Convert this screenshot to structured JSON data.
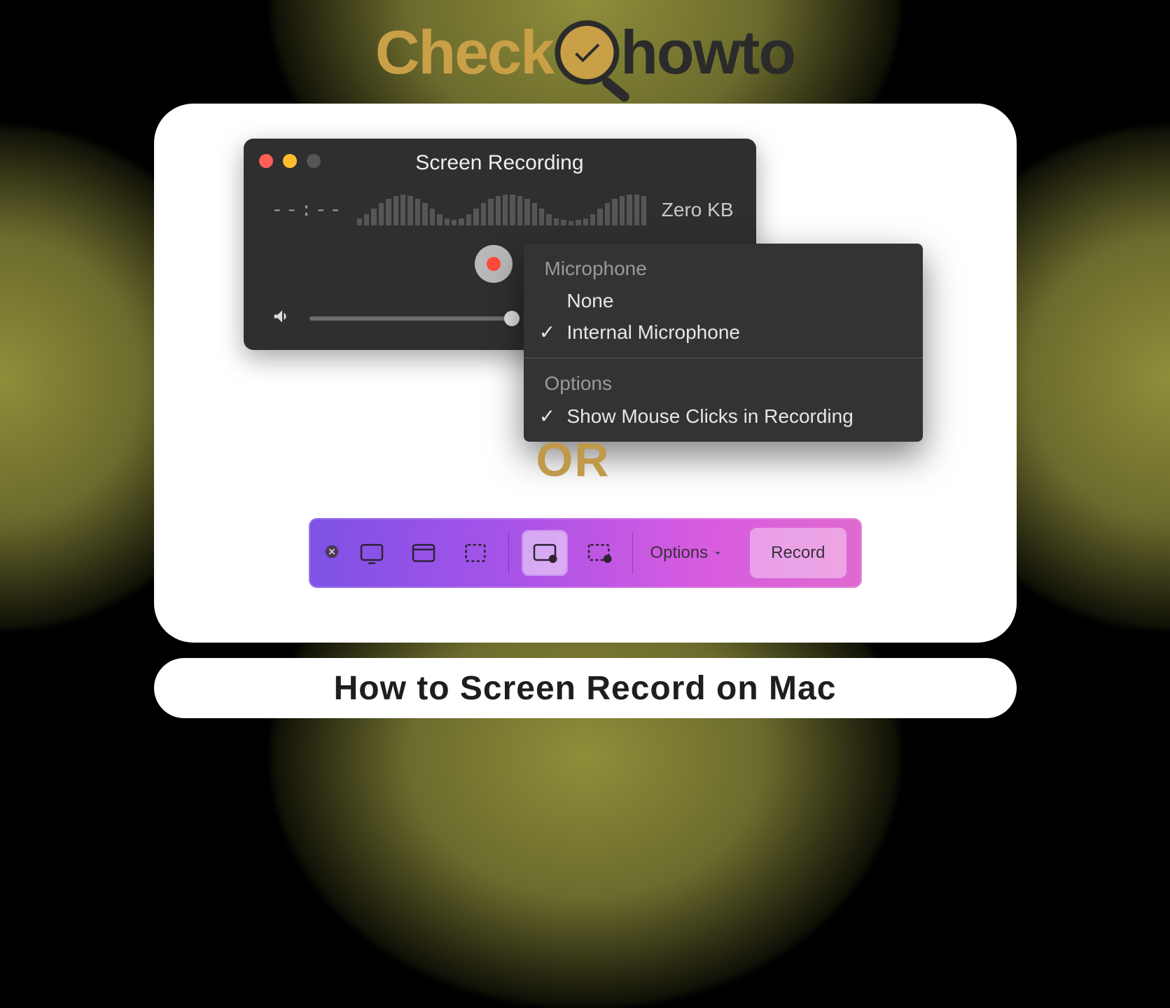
{
  "logo": {
    "part1": "Check",
    "part2": "howto"
  },
  "quicktime": {
    "title": "Screen Recording",
    "time": "--:--",
    "size": "Zero KB"
  },
  "menu": {
    "section1_header": "Microphone",
    "items1": [
      {
        "label": "None",
        "checked": false
      },
      {
        "label": "Internal Microphone",
        "checked": true
      }
    ],
    "section2_header": "Options",
    "items2": [
      {
        "label": "Show Mouse Clicks in Recording",
        "checked": true
      }
    ]
  },
  "or_label": "OR",
  "toolbar": {
    "options_label": "Options",
    "record_label": "Record"
  },
  "subtitle": "How to Screen Record on Mac"
}
